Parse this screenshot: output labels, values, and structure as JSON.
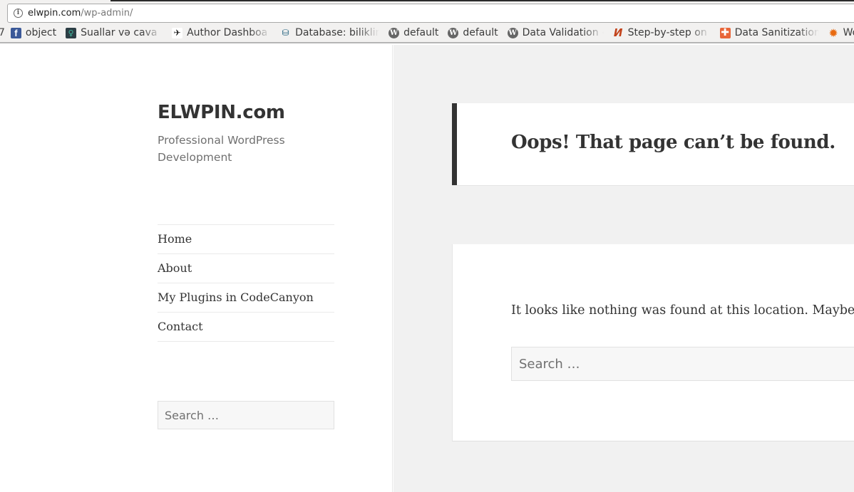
{
  "browser": {
    "url_host": "elwpin.com",
    "url_path": "/wp-admin/",
    "bookmarks_prefix": "7",
    "bookmarks": [
      {
        "label": "object",
        "icon": "facebook-icon",
        "glyph": "f"
      },
      {
        "label": "Suallar və cava",
        "icon": "lightbulb-icon",
        "glyph": "♀"
      },
      {
        "label": "Author Dashboa",
        "icon": "author-bird-icon",
        "glyph": "✈"
      },
      {
        "label": "Database: biliklin",
        "icon": "database-icon",
        "glyph": "⛁"
      },
      {
        "label": "default",
        "icon": "wordpress-icon",
        "glyph": "W"
      },
      {
        "label": "default",
        "icon": "wordpress-icon",
        "glyph": "W"
      },
      {
        "label": "Data Validation «",
        "icon": "wordpress-icon",
        "glyph": "W"
      },
      {
        "label": "Step-by-step on i",
        "icon": "n-logo-icon",
        "glyph": "И"
      },
      {
        "label": "Data Sanitization",
        "icon": "plus-icon",
        "glyph": "✚"
      },
      {
        "label": "Wo",
        "icon": "gear-icon",
        "glyph": "✹"
      }
    ]
  },
  "sidebar": {
    "site_title": "ELWPIN.com",
    "site_description": "Professional WordPress Development",
    "nav": [
      {
        "label": "Home"
      },
      {
        "label": "About"
      },
      {
        "label": "My Plugins in CodeCanyon"
      },
      {
        "label": "Contact"
      }
    ],
    "search_placeholder": "Search …"
  },
  "main": {
    "page_title": "Oops! That page can’t be found.",
    "message": "It looks like nothing was found at this location. Maybe try a search?",
    "search_placeholder": "Search …"
  }
}
